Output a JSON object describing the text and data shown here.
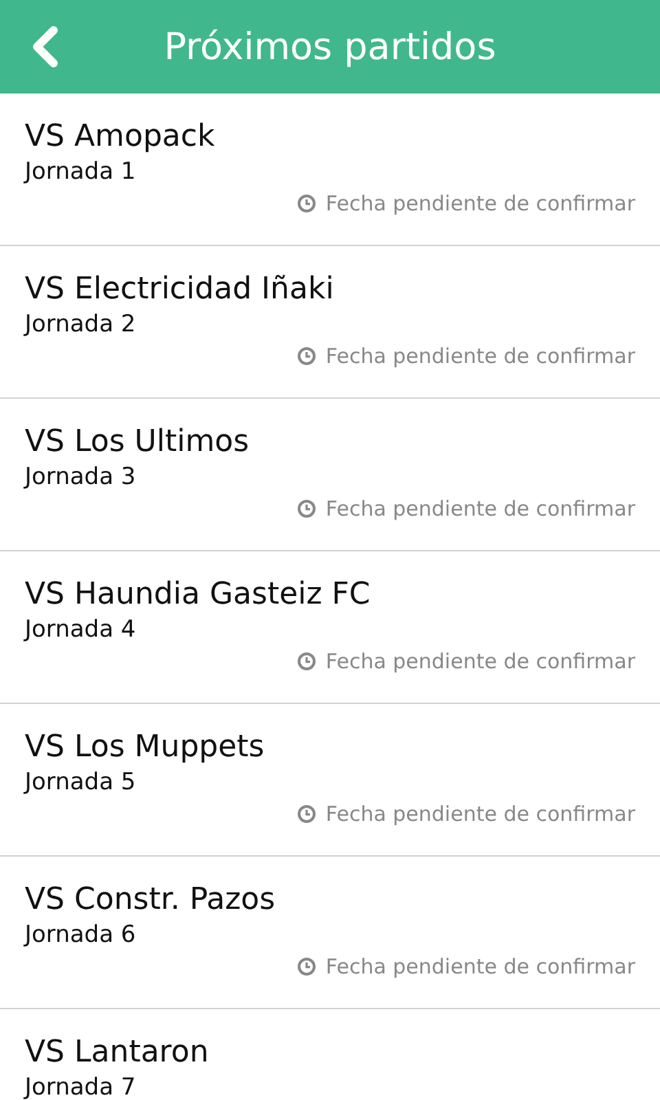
{
  "header": {
    "title": "Próximos partidos"
  },
  "matches": [
    {
      "title": "VS Amopack",
      "round": "Jornada 1",
      "status": "Fecha pendiente de confirmar"
    },
    {
      "title": "VS Electricidad Iñaki",
      "round": "Jornada 2",
      "status": "Fecha pendiente de confirmar"
    },
    {
      "title": "VS Los Ultimos",
      "round": "Jornada 3",
      "status": "Fecha pendiente de confirmar"
    },
    {
      "title": "VS Haundia Gasteiz FC",
      "round": "Jornada 4",
      "status": "Fecha pendiente de confirmar"
    },
    {
      "title": "VS Los Muppets",
      "round": "Jornada 5",
      "status": "Fecha pendiente de confirmar"
    },
    {
      "title": "VS Constr. Pazos",
      "round": "Jornada 6",
      "status": "Fecha pendiente de confirmar"
    },
    {
      "title": "VS Lantaron",
      "round": "Jornada 7"
    }
  ]
}
